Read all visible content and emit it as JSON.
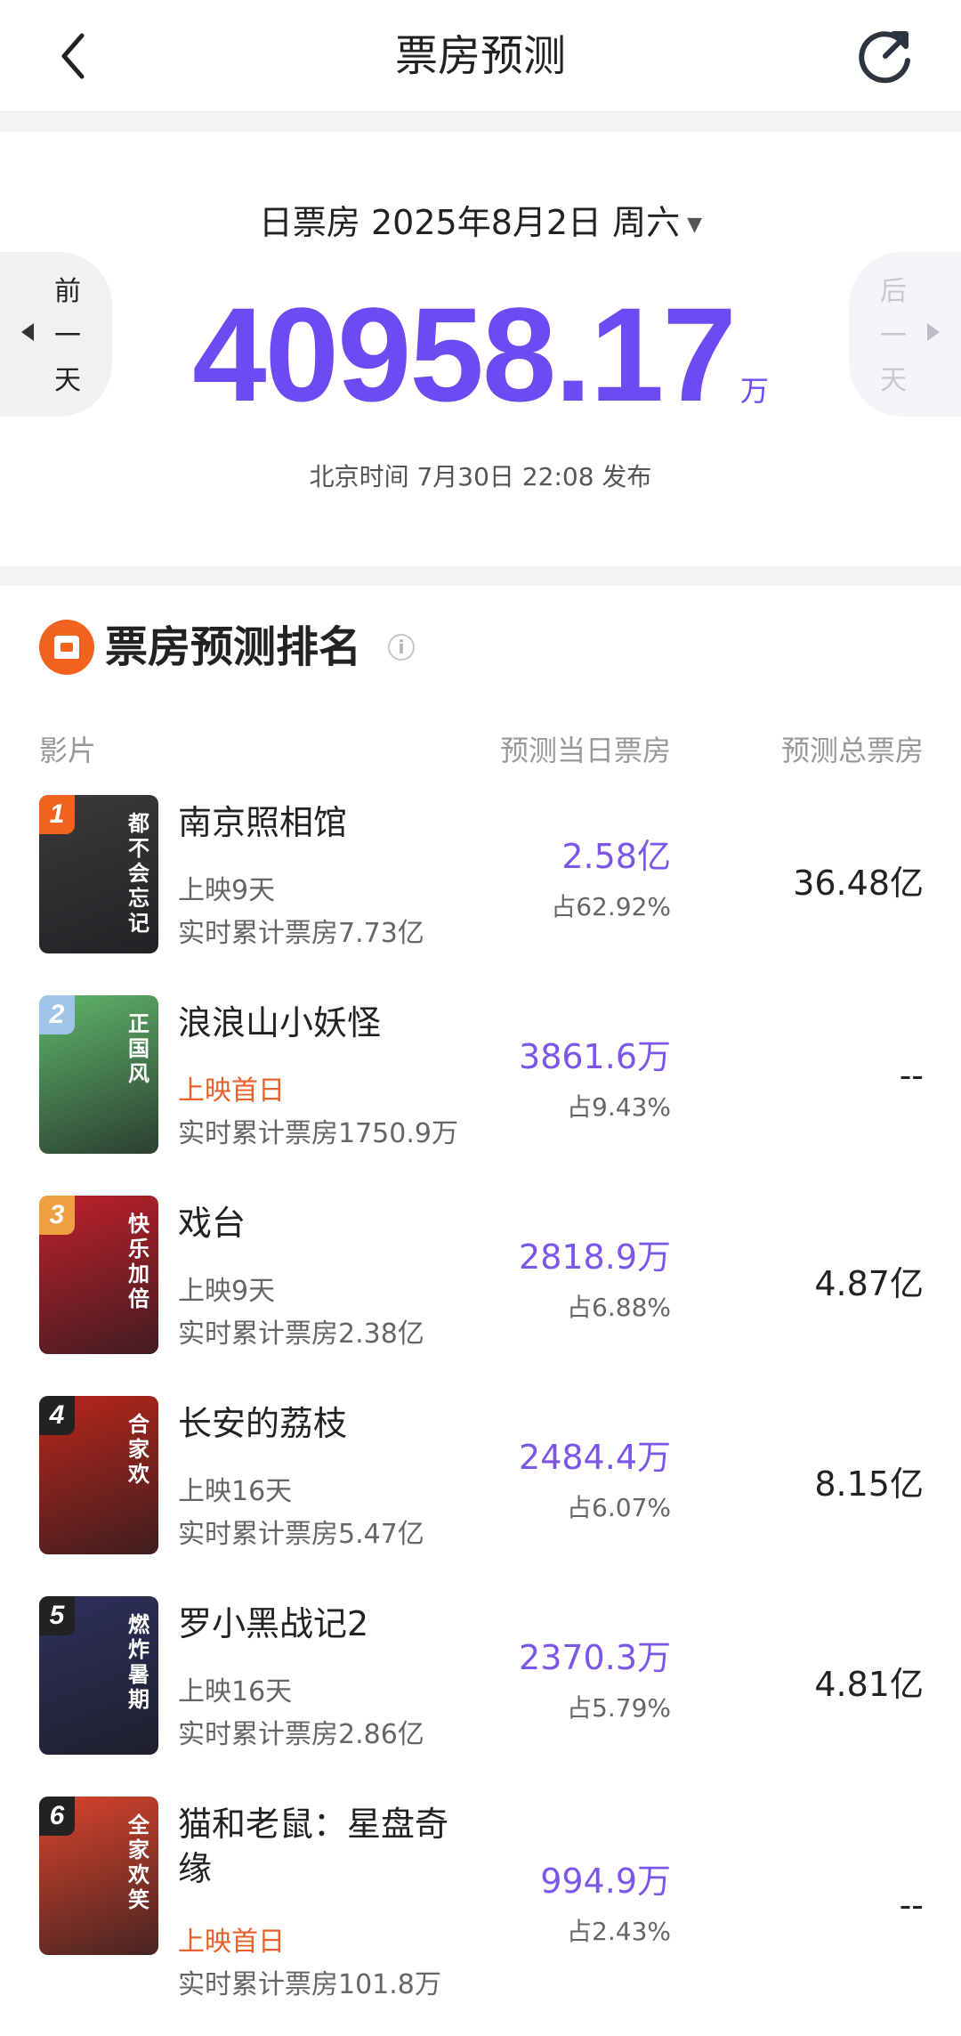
{
  "header": {
    "title": "票房预测"
  },
  "summary": {
    "date_label": "日票房 2025年8月2日 周六",
    "prev_label": "前一天",
    "next_label": "后一天",
    "total_value": "40958.17",
    "total_unit": "万",
    "publish_note": "北京时间 7月30日 22:08 发布"
  },
  "ranking": {
    "title": "票房预测排名",
    "col_film": "影片",
    "col_day": "预测当日票房",
    "col_total": "预测总票房",
    "films": [
      {
        "rank": "1",
        "name": "南京照相馆",
        "release": "上映9天",
        "cumulative": "实时累计票房7.73亿",
        "day_value": "2.58亿",
        "day_share": "占62.92%",
        "total": "36.48亿",
        "poster_text": "都不会忘记",
        "poster_color": "#3a3a3c",
        "badge_color": "#f2621f"
      },
      {
        "rank": "2",
        "name": "浪浪山小妖怪",
        "release": "上映首日",
        "cumulative": "实时累计票房1750.9万",
        "day_value": "3861.6万",
        "day_share": "占9.43%",
        "total": "--",
        "poster_text": "正国风",
        "poster_color": "#5fb56a",
        "badge_color": "#9fc4e8"
      },
      {
        "rank": "3",
        "name": "戏台",
        "release": "上映9天",
        "cumulative": "实时累计票房2.38亿",
        "day_value": "2818.9万",
        "day_share": "占6.88%",
        "total": "4.87亿",
        "poster_text": "快乐加倍",
        "poster_color": "#c0202a",
        "badge_color": "#f0a040"
      },
      {
        "rank": "4",
        "name": "长安的荔枝",
        "release": "上映16天",
        "cumulative": "实时累计票房5.47亿",
        "day_value": "2484.4万",
        "day_share": "占6.07%",
        "total": "8.15亿",
        "poster_text": "合家欢",
        "poster_color": "#b8261c",
        "badge_color": "#222222"
      },
      {
        "rank": "5",
        "name": "罗小黑战记2",
        "release": "上映16天",
        "cumulative": "实时累计票房2.86亿",
        "day_value": "2370.3万",
        "day_share": "占5.79%",
        "total": "4.81亿",
        "poster_text": "燃炸暑期",
        "poster_color": "#2e2f5c",
        "badge_color": "#222222"
      },
      {
        "rank": "6",
        "name": "猫和老鼠：星盘奇缘",
        "release": "上映首日",
        "cumulative": "实时累计票房101.8万",
        "day_value": "994.9万",
        "day_share": "占2.43%",
        "total": "--",
        "poster_text": "全家欢笑",
        "poster_color": "#d9432c",
        "badge_color": "#222222"
      }
    ]
  }
}
